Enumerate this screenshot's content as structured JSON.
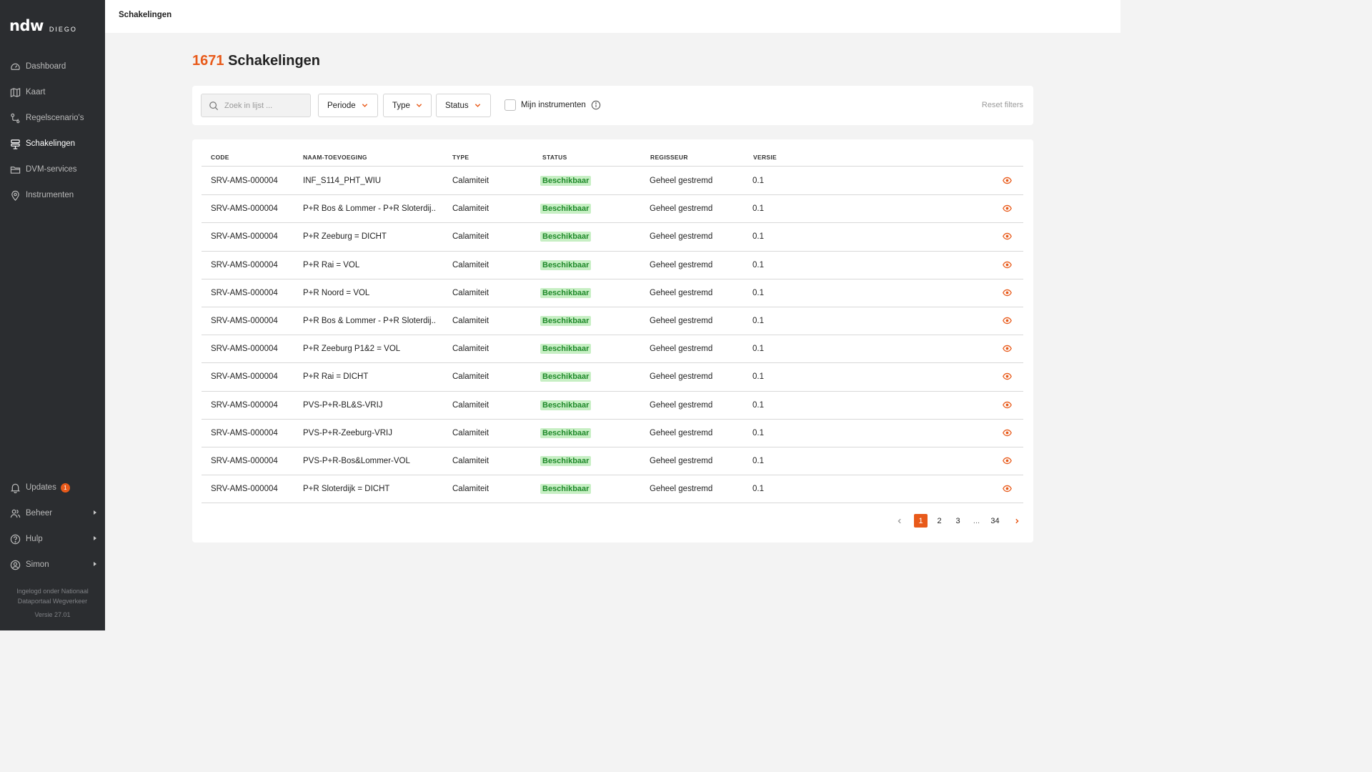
{
  "app": {
    "logo": "ndw",
    "logo_sub": "DIEGO"
  },
  "sidebar": {
    "items": [
      {
        "label": "Dashboard",
        "icon": "gauge-icon",
        "active": false
      },
      {
        "label": "Kaart",
        "icon": "map-icon",
        "active": false
      },
      {
        "label": "Regelscenario's",
        "icon": "scenario-icon",
        "active": false
      },
      {
        "label": "Schakelingen",
        "icon": "stack-icon",
        "active": true
      },
      {
        "label": "DVM-services",
        "icon": "folder-icon",
        "active": false
      },
      {
        "label": "Instrumenten",
        "icon": "pin-icon",
        "active": false
      }
    ],
    "bottom": {
      "updates": {
        "label": "Updates",
        "badge": "1"
      },
      "beheer": {
        "label": "Beheer"
      },
      "hulp": {
        "label": "Hulp"
      },
      "user": {
        "label": "Simon"
      }
    },
    "login_info_line1": "Ingelogd onder Nationaal",
    "login_info_line2": "Dataportaal Wegverkeer",
    "version": "Versie 27.01"
  },
  "topbar": {
    "title": "Schakelingen"
  },
  "page": {
    "count": "1671",
    "title": "Schakelingen"
  },
  "filters": {
    "search_placeholder": "Zoek in lijst ...",
    "periode": "Periode",
    "type": "Type",
    "status": "Status",
    "mijn_instrumenten": "Mijn instrumenten",
    "reset": "Reset filters"
  },
  "table": {
    "headers": {
      "code": "CODE",
      "naam": "NAAM-TOEVOEGING",
      "type": "TYPE",
      "status": "STATUS",
      "regisseur": "REGISSEUR",
      "versie": "VERSIE"
    },
    "rows": [
      {
        "code": "SRV-AMS-000004",
        "naam": "INF_S114_PHT_WIU",
        "type": "Calamiteit",
        "status": "Beschikbaar",
        "regisseur": "Geheel gestremd",
        "versie": "0.1"
      },
      {
        "code": "SRV-AMS-000004",
        "naam": "P+R Bos & Lommer - P+R Sloterdij...",
        "type": "Calamiteit",
        "status": "Beschikbaar",
        "regisseur": "Geheel gestremd",
        "versie": "0.1"
      },
      {
        "code": "SRV-AMS-000004",
        "naam": "P+R Zeeburg = DICHT",
        "type": "Calamiteit",
        "status": "Beschikbaar",
        "regisseur": "Geheel gestremd",
        "versie": "0.1"
      },
      {
        "code": "SRV-AMS-000004",
        "naam": "P+R Rai = VOL",
        "type": "Calamiteit",
        "status": "Beschikbaar",
        "regisseur": "Geheel gestremd",
        "versie": "0.1"
      },
      {
        "code": "SRV-AMS-000004",
        "naam": "P+R Noord = VOL",
        "type": "Calamiteit",
        "status": "Beschikbaar",
        "regisseur": "Geheel gestremd",
        "versie": "0.1"
      },
      {
        "code": "SRV-AMS-000004",
        "naam": "P+R Bos & Lommer - P+R Sloterdij...",
        "type": "Calamiteit",
        "status": "Beschikbaar",
        "regisseur": "Geheel gestremd",
        "versie": "0.1"
      },
      {
        "code": "SRV-AMS-000004",
        "naam": "P+R Zeeburg P1&2 = VOL",
        "type": "Calamiteit",
        "status": "Beschikbaar",
        "regisseur": "Geheel gestremd",
        "versie": "0.1"
      },
      {
        "code": "SRV-AMS-000004",
        "naam": "P+R Rai = DICHT",
        "type": "Calamiteit",
        "status": "Beschikbaar",
        "regisseur": "Geheel gestremd",
        "versie": "0.1"
      },
      {
        "code": "SRV-AMS-000004",
        "naam": "PVS-P+R-BL&S-VRIJ",
        "type": "Calamiteit",
        "status": "Beschikbaar",
        "regisseur": "Geheel gestremd",
        "versie": "0.1"
      },
      {
        "code": "SRV-AMS-000004",
        "naam": "PVS-P+R-Zeeburg-VRIJ",
        "type": "Calamiteit",
        "status": "Beschikbaar",
        "regisseur": "Geheel gestremd",
        "versie": "0.1"
      },
      {
        "code": "SRV-AMS-000004",
        "naam": "PVS-P+R-Bos&Lommer-VOL",
        "type": "Calamiteit",
        "status": "Beschikbaar",
        "regisseur": "Geheel gestremd",
        "versie": "0.1"
      },
      {
        "code": "SRV-AMS-000004",
        "naam": "P+R Sloterdijk = DICHT",
        "type": "Calamiteit",
        "status": "Beschikbaar",
        "regisseur": "Geheel gestremd",
        "versie": "0.1"
      }
    ]
  },
  "pagination": {
    "pages": [
      "1",
      "2",
      "3",
      "...",
      "34"
    ],
    "current": "1"
  },
  "colors": {
    "accent": "#e85a1a",
    "sidebar": "#2b2d30",
    "status_bg": "#c7efc4",
    "status_text": "#1f8a2a"
  }
}
